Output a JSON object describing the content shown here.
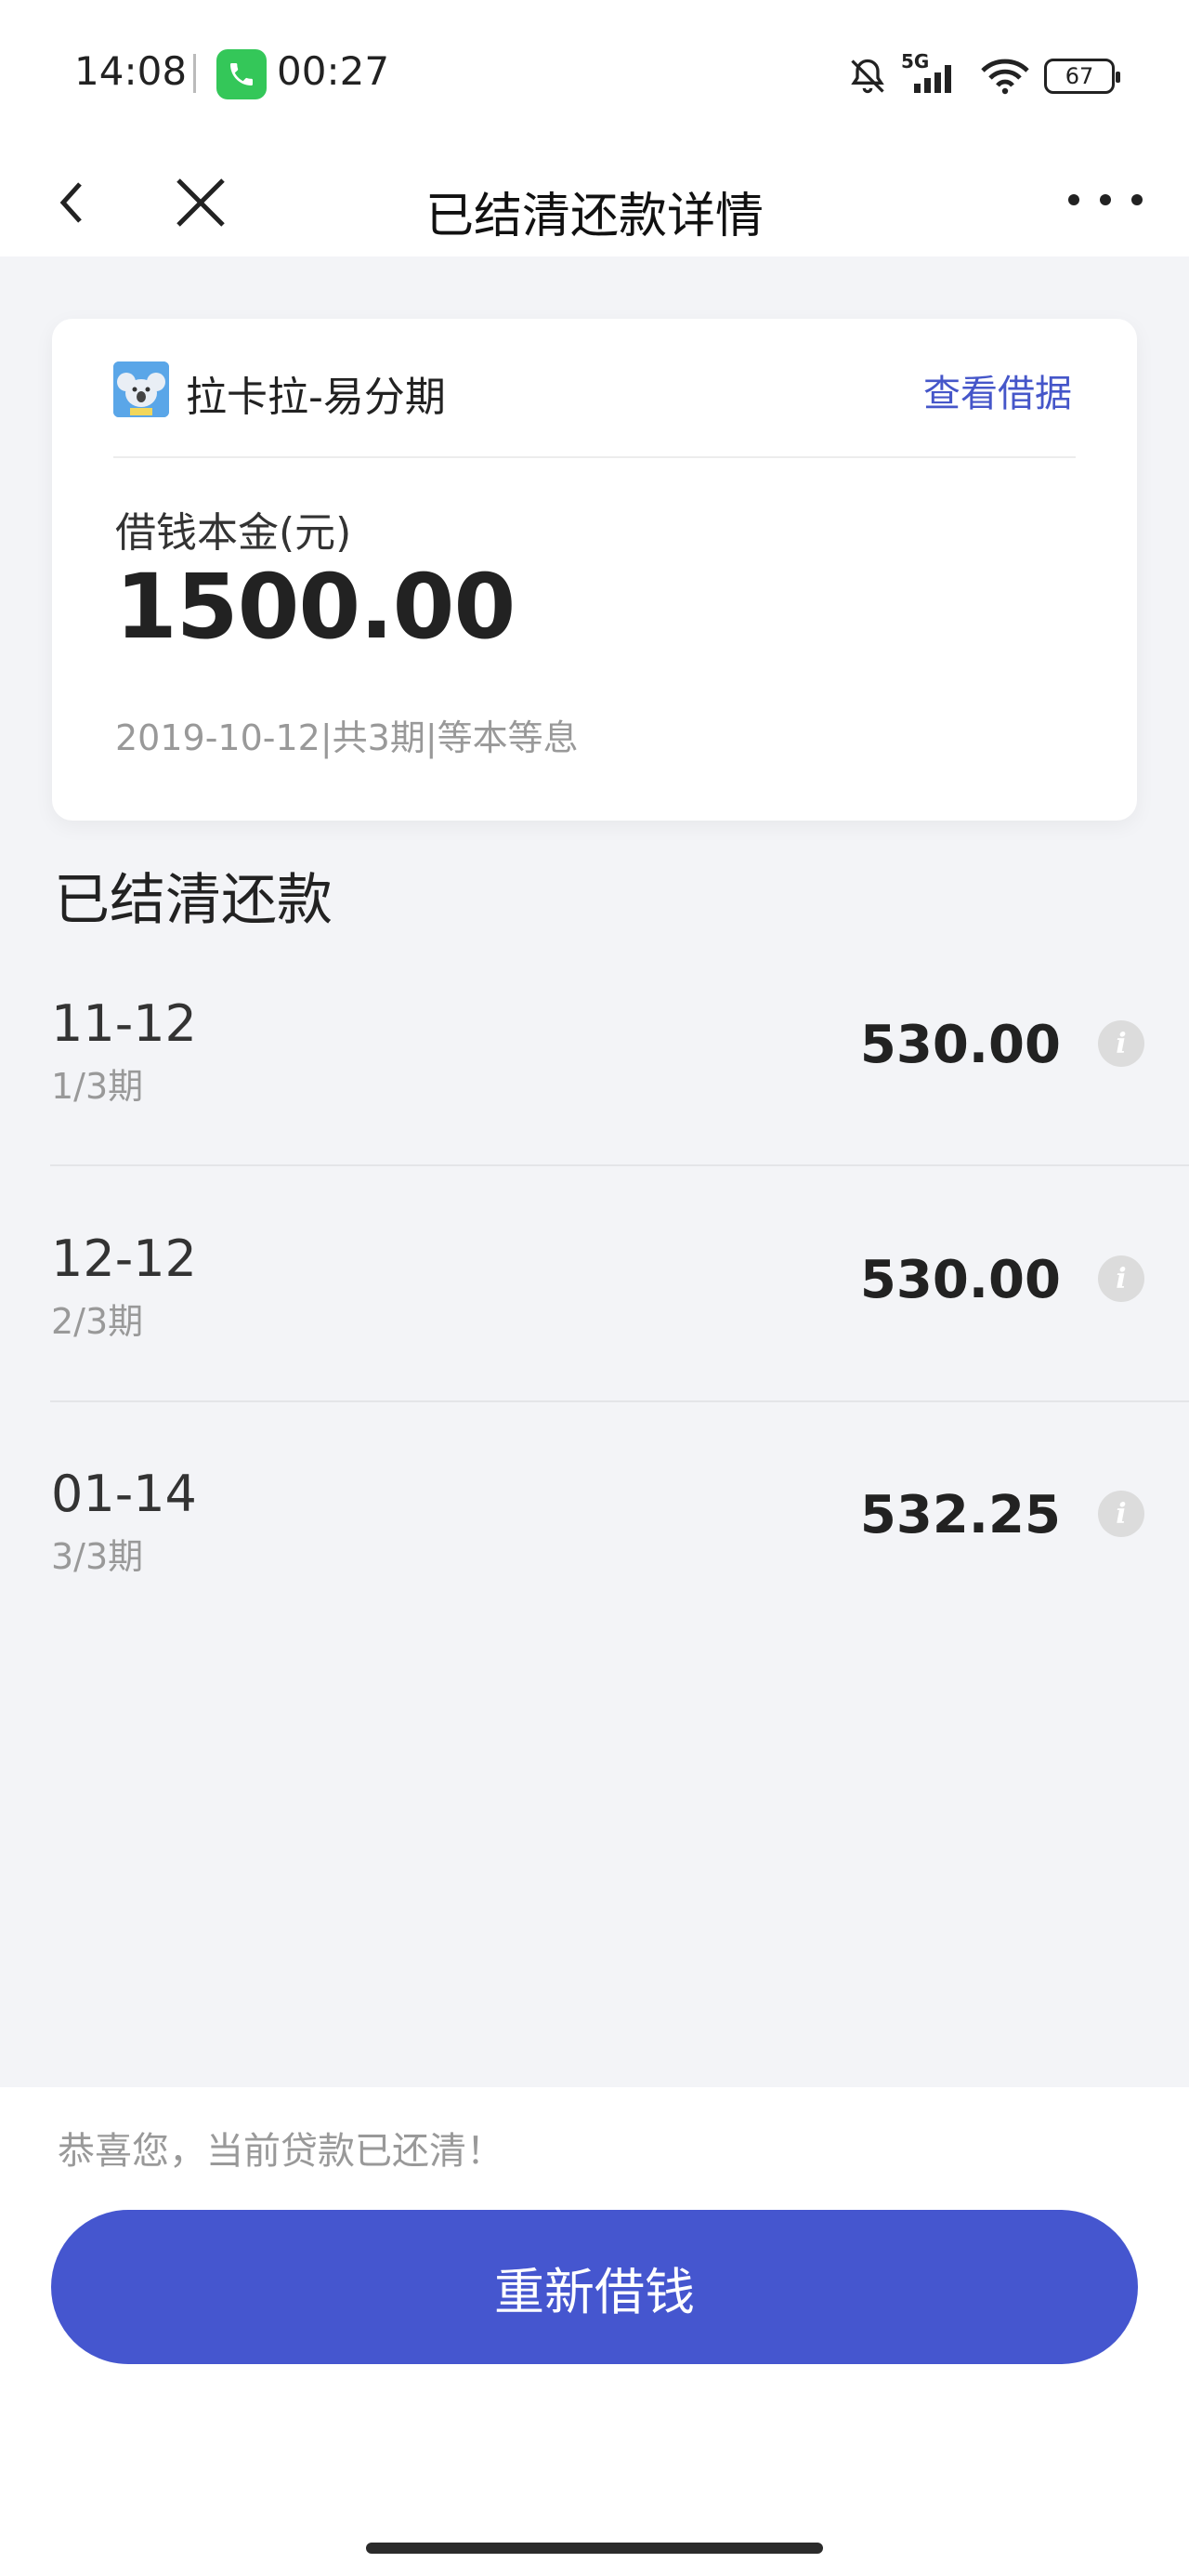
{
  "status_bar": {
    "time": "14:08",
    "call_duration": "00:27",
    "network": "5G",
    "battery": "67"
  },
  "nav": {
    "title": "已结清还款详情"
  },
  "loan_card": {
    "lender_name": "拉卡拉-易分期",
    "view_receipt_label": "查看借据",
    "principal_label": "借钱本金(元)",
    "principal_value": "1500.00",
    "meta": "2019-10-12|共3期|等本等息"
  },
  "repayments": {
    "section_title": "已结清还款",
    "items": [
      {
        "date": "11-12",
        "period": "1/3期",
        "amount": "530.00"
      },
      {
        "date": "12-12",
        "period": "2/3期",
        "amount": "530.00"
      },
      {
        "date": "01-14",
        "period": "3/3期",
        "amount": "532.25"
      }
    ]
  },
  "footer": {
    "congrats_text": "恭喜您，当前贷款已还清！",
    "reborrow_label": "重新借钱"
  },
  "colors": {
    "accent": "#4556cf",
    "link": "#4556c9",
    "background": "#f3f4f7"
  }
}
